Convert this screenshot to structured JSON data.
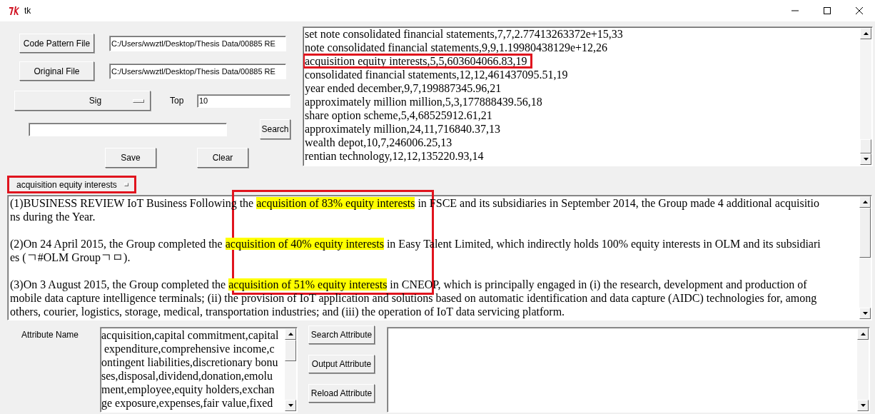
{
  "window": {
    "title": "tk"
  },
  "file_buttons": [
    {
      "label": "Code Pattern File",
      "path": "C:/Users/wwztl/Desktop/Thesis Data/00885 RE"
    },
    {
      "label": "Original File",
      "path": "C:/Users/wwztl/Desktop/Thesis Data/00885 RE"
    }
  ],
  "mode_menu": {
    "value": "Sig"
  },
  "top": {
    "label": "Top",
    "value": "10"
  },
  "search": {
    "button": "Search"
  },
  "actions": [
    "Save",
    "Clear"
  ],
  "results": {
    "lines": [
      {
        "text": "set note consolidated financial statements,7,7,2.77413263372e+15,33",
        "marked": false
      },
      {
        "text": "note consolidated financial statements,9,9,1.19980438129e+12,26",
        "marked": false
      },
      {
        "text": "acquisition equity interests,5,5,603604066.83,19",
        "marked": true
      },
      {
        "text": "consolidated financial statements,12,12,461437095.51,19",
        "marked": false
      },
      {
        "text": "year ended december,9,7,199887345.96,21",
        "marked": false
      },
      {
        "text": "approximately million million,5,3,177888439.56,18",
        "marked": false
      },
      {
        "text": "share option scheme,5,4,68525912.61,21",
        "marked": false
      },
      {
        "text": "approximately million,24,11,716840.37,13",
        "marked": false
      },
      {
        "text": "wealth depot,10,7,246006.25,13",
        "marked": false
      },
      {
        "text": "rentian technology,12,12,135220.93,14",
        "marked": false
      }
    ]
  },
  "selector": {
    "value": "acquisition equity interests",
    "marked": true
  },
  "document": {
    "marked_region": true,
    "paragraphs": [
      {
        "lines": [
          [
            {
              "text": "(1)BUSINESS REVIEW IoT Business Following the ",
              "highlight": false
            },
            {
              "text": "acquisition of 83% equity interests",
              "highlight": true
            },
            {
              "text": " in FSCE and its subsidiaries in September 2014, the Group made 4 additional acquisitio",
              "highlight": false
            }
          ],
          [
            {
              "text": "ns during the Year.",
              "highlight": false
            }
          ]
        ]
      },
      {
        "lines": [
          [
            {
              "text": "(2)On 24 April 2015, the Group completed the ",
              "highlight": false
            },
            {
              "text": "acquisition of 40% equity interests",
              "highlight": true
            },
            {
              "text": " in Easy Talent Limited, which indirectly holds 100% equity interests in OLM and its subsidiari",
              "highlight": false
            }
          ],
          [
            {
              "text": "es (ㄱ#OLM Groupㄱㅁ).",
              "highlight": false
            }
          ]
        ]
      },
      {
        "lines": [
          [
            {
              "text": "(3)On 3 August 2015, the Group completed the ",
              "highlight": false
            },
            {
              "text": "acquisition of 51% equity interests",
              "highlight": true
            },
            {
              "text": " in CNEOP, which is principally engaged in (i) the research, development and production of",
              "highlight": false
            }
          ],
          [
            {
              "text": "mobile data capture intelligence terminals; (ii) the provision of IoT application and solutions based on automatic identification and data capture (AIDC) technologies for, among",
              "highlight": false
            }
          ],
          [
            {
              "text": "others, courier, logistics, storage, medical, transportation industries; and (iii) the operation of IoT data servicing platform.",
              "highlight": false
            }
          ]
        ]
      }
    ]
  },
  "attributes": {
    "label": "Attribute Name",
    "lines": [
      "acquisition,capital commitment,capital",
      " expenditure,comprehensive income,c",
      "ontingent liabilities,discretionary bonu",
      "ses,disposal,dividend,donation,emolu",
      "ment,employee,equity holders,exchan",
      "ge exposure,expenses,fair value,fixed"
    ]
  },
  "attribute_buttons": [
    "Search Attribute",
    "Output Attribute",
    "Reload Attribute"
  ]
}
